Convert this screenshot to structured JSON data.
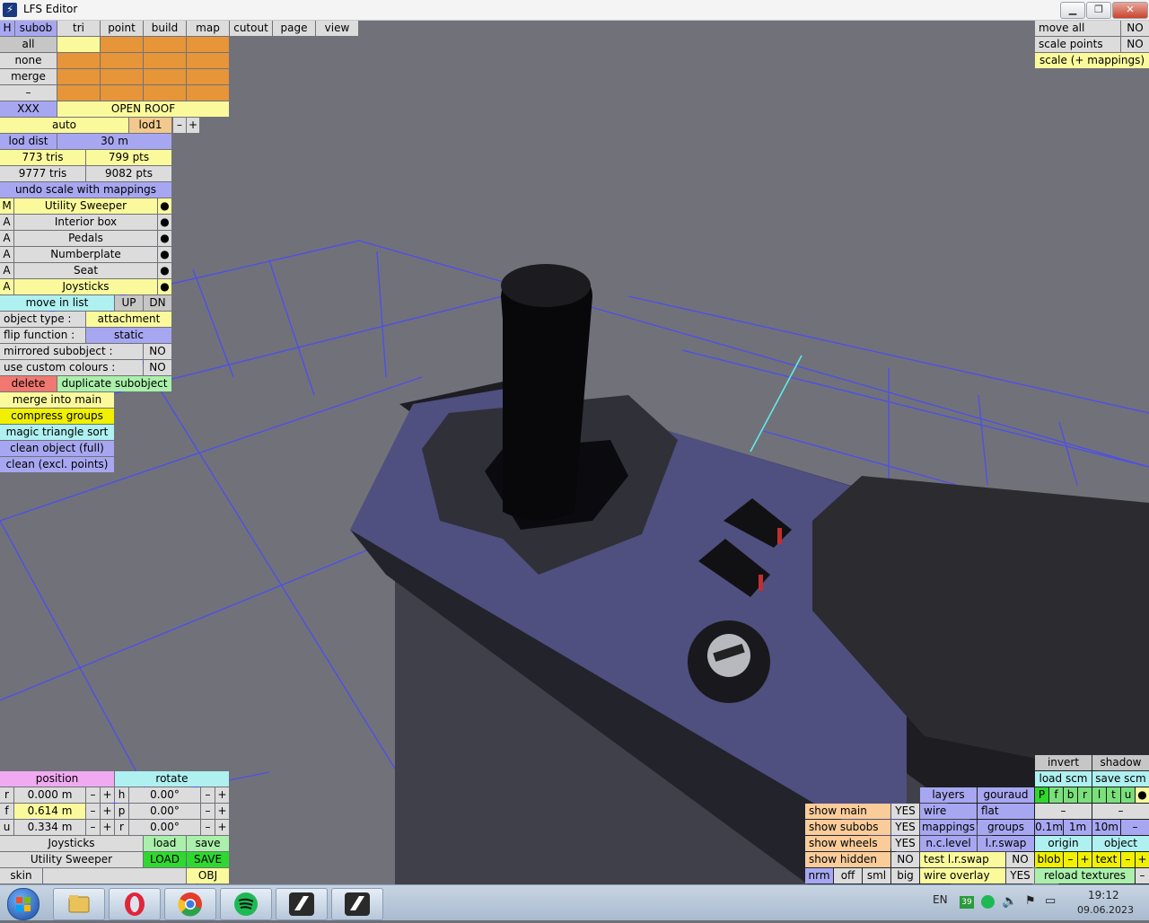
{
  "window": {
    "title": "LFS Editor",
    "app_icon": "lfs-app-icon",
    "controls": [
      "minimize-icon",
      "restore-icon",
      "close-icon"
    ]
  },
  "menu": {
    "h": "H",
    "tabs": [
      "subob",
      "tri",
      "point",
      "build",
      "map",
      "cutout",
      "page",
      "view"
    ]
  },
  "left": {
    "rows": [
      "all",
      "none",
      "merge",
      "–"
    ],
    "xxx": "XXX",
    "open_roof": "OPEN ROOF",
    "auto": "auto",
    "lod": "lod1",
    "minus": "–",
    "plus": "+",
    "lod_dist": "lod dist",
    "lod_dist_val": "30 m",
    "tris1": "773 tris",
    "pts1": "799 pts",
    "tris2": "9777 tris",
    "pts2": "9082 pts",
    "undo_scale": "undo scale with mappings",
    "subobjects": [
      {
        "flag": "M",
        "name": "Utility Sweeper"
      },
      {
        "flag": "A",
        "name": "Interior box"
      },
      {
        "flag": "A",
        "name": "Pedals"
      },
      {
        "flag": "A",
        "name": "Numberplate"
      },
      {
        "flag": "A",
        "name": "Seat"
      },
      {
        "flag": "A",
        "name": "Joysticks"
      }
    ],
    "dot": "●",
    "move_in_list": "move in list",
    "up": "UP",
    "dn": "DN",
    "object_type": "object type :",
    "object_type_val": "attachment",
    "flip_function": "flip function :",
    "flip_function_val": "static",
    "mirrored": "mirrored subobject :",
    "mirrored_val": "NO",
    "custom_colours": "use custom colours :",
    "custom_colours_val": "NO",
    "delete": "delete",
    "duplicate": "duplicate subobject",
    "merge_into_main": "merge into main",
    "compress_groups": "compress groups",
    "magic_sort": "magic triangle sort",
    "clean_full": "clean object (full)",
    "clean_excl": "clean (excl. points)"
  },
  "topright": {
    "move_all": "move all",
    "move_all_val": "NO",
    "scale_points": "scale points",
    "scale_points_val": "NO",
    "scale_mappings": "scale (+ mappings)"
  },
  "bottomleft": {
    "position": "position",
    "rotate": "rotate",
    "pos": [
      {
        "axis": "r",
        "val": "0.000 m"
      },
      {
        "axis": "f",
        "val": "0.614 m"
      },
      {
        "axis": "u",
        "val": "0.334 m"
      }
    ],
    "rot": [
      {
        "axis": "h",
        "val": "0.00°"
      },
      {
        "axis": "p",
        "val": "0.00°"
      },
      {
        "axis": "r",
        "val": "0.00°"
      }
    ],
    "minus": "–",
    "plus": "+",
    "sub_name": "Joysticks",
    "load": "load",
    "save": "save",
    "obj_name": "Utility Sweeper",
    "load2": "LOAD",
    "save2": "SAVE",
    "skin": "skin",
    "obj": "OBJ"
  },
  "bottomright": {
    "invert": "invert",
    "shadow": "shadow",
    "load_scm": "load scm",
    "save_scm": "save scm",
    "letters": [
      "P",
      "f",
      "b",
      "r",
      "l",
      "t",
      "u",
      "●"
    ],
    "dash": "–",
    "show": [
      {
        "label": "show main",
        "val": "YES"
      },
      {
        "label": "show subobs",
        "val": "YES"
      },
      {
        "label": "show wheels",
        "val": "YES"
      },
      {
        "label": "show hidden",
        "val": "NO"
      }
    ],
    "nrm": "nrm",
    "off": "off",
    "sml": "sml",
    "big": "big",
    "layers": "layers",
    "gouraud": "gouraud",
    "wire": "wire",
    "flat": "flat",
    "mappings": "mappings",
    "groups": "groups",
    "nclevel": "n.c.level",
    "lrswap": "l.r.swap",
    "test_lrswap": "test l.r.swap",
    "test_lrswap_val": "NO",
    "wire_overlay": "wire overlay",
    "wire_overlay_val": "YES",
    "g01": "0.1m",
    "g1": "1m",
    "g10": "10m",
    "origin": "origin",
    "object": "object",
    "blob": "blob",
    "text": "text",
    "reload": "reload textures"
  },
  "taskbar": {
    "apps": [
      "windows-start-icon",
      "file-explorer-icon",
      "opera-icon",
      "chrome-icon",
      "spotify-icon",
      "lfs-icon",
      "lfs-editor-icon"
    ],
    "lang": "EN",
    "badge": "39",
    "time": "19:12",
    "date": "09.06.2023"
  }
}
